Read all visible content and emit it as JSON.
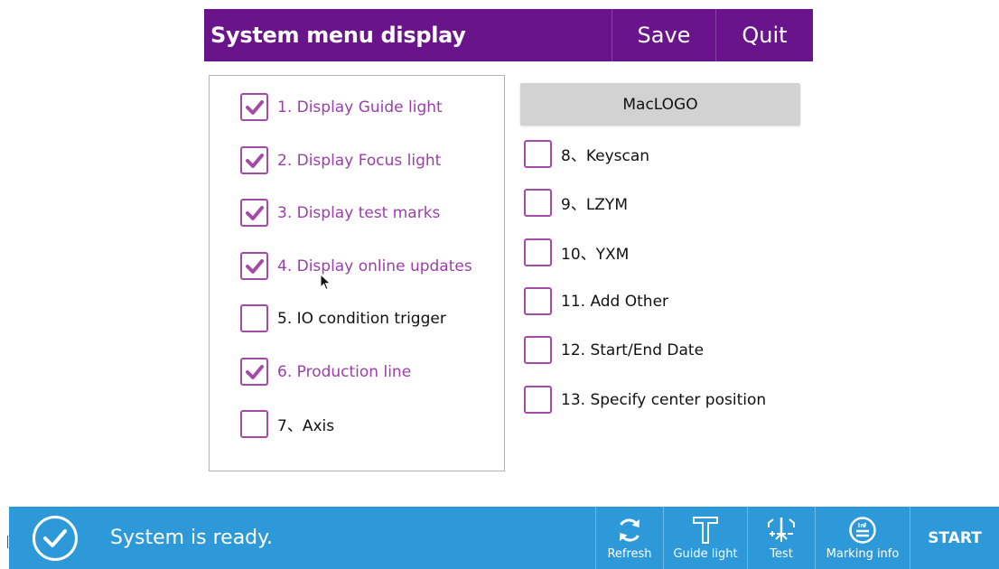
{
  "header": {
    "title": "System menu display",
    "save_label": "Save",
    "quit_label": "Quit"
  },
  "left_options": [
    {
      "label": "1. Display Guide light",
      "checked": true
    },
    {
      "label": "2. Display Focus light",
      "checked": true
    },
    {
      "label": "3. Display test marks",
      "checked": true
    },
    {
      "label": "4. Display online updates",
      "checked": true
    },
    {
      "label": "5. IO condition trigger",
      "checked": false
    },
    {
      "label": "6. Production line",
      "checked": true
    },
    {
      "label": "7、Axis",
      "checked": false
    }
  ],
  "right_panel": {
    "maclogo_label": "MacLOGO",
    "options": [
      {
        "label": "8、Keyscan",
        "checked": false
      },
      {
        "label": "9、LZYM",
        "checked": false
      },
      {
        "label": "10、YXM",
        "checked": false
      },
      {
        "label": "11. Add Other",
        "checked": false
      },
      {
        "label": "12. Start/End Date",
        "checked": false
      },
      {
        "label": "13. Specify center position",
        "checked": false
      }
    ]
  },
  "statusbar": {
    "status_text": "System is ready.",
    "buttons": {
      "refresh": "Refresh",
      "guide_light": "Guide light",
      "test": "Test",
      "marking_info": "Marking info",
      "start": "START"
    }
  },
  "colors": {
    "header_bg": "#6a148c",
    "checked_text": "#9b3fa8",
    "checkbox_border": "#a64aa8",
    "statusbar_bg": "#2d99d9"
  }
}
